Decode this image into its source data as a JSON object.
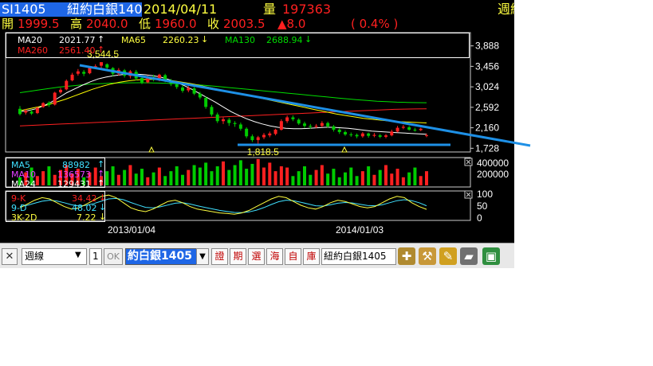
{
  "header": {
    "symbol": "SI1405",
    "name": "紐約白銀140",
    "date": "2014/04/11",
    "volume_label": "量",
    "volume_value": "197363",
    "period_label": "週綫",
    "open_label": "開",
    "open": "1999.5",
    "high_label": "高",
    "high": "2040.0",
    "low_label": "低",
    "low": "1960.0",
    "close_label": "收",
    "close": "2003.5",
    "change": "▲8.0",
    "change_pct": "( 0.4% )"
  },
  "price_legend": {
    "ma20_label": "MA20",
    "ma20_value": "2021.77",
    "ma65_label": "MA65",
    "ma65_value": "2260.23",
    "ma130_label": "MA130",
    "ma130_value": "2688.94",
    "ma260_label": "MA260",
    "ma260_value": "2561.40"
  },
  "volume_legend": {
    "ma5_label": "MA5",
    "ma5_value": "88982",
    "ma10_label": "MA10",
    "ma10_value": "136573",
    "ma24_label": "MA24",
    "ma24_value": "129431"
  },
  "kd_legend": {
    "k_label": "9-K",
    "k_value": "34.42",
    "d_label": "9-D",
    "d_value": "48.02",
    "j_label": "3K-2D",
    "j_value": "7.22"
  },
  "toolbar": {
    "period_select": "週線",
    "count_value": "1",
    "ok_label": "OK",
    "symbol_input": "約白銀1405",
    "buttons": [
      "證",
      "期",
      "選",
      "海",
      "自",
      "庫"
    ],
    "name_display": "紐約白銀1405"
  },
  "colors": {
    "up": "#ff2020",
    "down": "#00cc00",
    "ma20": "#ffffff",
    "ma65": "#ffff00",
    "ma130": "#00dd00",
    "ma260": "#ff2020",
    "trendline": "#1e90e6",
    "accent": "#1e66e6"
  },
  "chart_data": [
    {
      "type": "candlestick",
      "title": "SI1405 weekly",
      "y_ticks": [
        "3,888",
        "3,456",
        "3,024",
        "2,592",
        "2,160",
        "1,728"
      ],
      "ylim": [
        1700,
        4050
      ],
      "x_ticks": [
        "2013/01/04",
        "2014/01/03"
      ],
      "annotations": {
        "high": "3,544.5",
        "low": "1,818.5"
      },
      "candles": [
        [
          2560,
          2450,
          2620,
          2420
        ],
        [
          2480,
          2520,
          2560,
          2440
        ],
        [
          2500,
          2460,
          2540,
          2430
        ],
        [
          2470,
          2580,
          2600,
          2450
        ],
        [
          2600,
          2680,
          2700,
          2580
        ],
        [
          2690,
          2640,
          2720,
          2600
        ],
        [
          2650,
          2900,
          2920,
          2630
        ],
        [
          2910,
          2960,
          3000,
          2880
        ],
        [
          2970,
          3150,
          3180,
          2950
        ],
        [
          3160,
          3280,
          3320,
          3140
        ],
        [
          3300,
          3350,
          3400,
          3260
        ],
        [
          3340,
          3300,
          3380,
          3250
        ],
        [
          3310,
          3420,
          3460,
          3290
        ],
        [
          3420,
          3460,
          3500,
          3400
        ],
        [
          3470,
          3544,
          3544,
          3420
        ],
        [
          3500,
          3430,
          3520,
          3380
        ],
        [
          3420,
          3300,
          3440,
          3250
        ],
        [
          3300,
          3380,
          3420,
          3260
        ],
        [
          3370,
          3260,
          3400,
          3220
        ],
        [
          3250,
          3350,
          3380,
          3200
        ],
        [
          3340,
          3200,
          3380,
          3160
        ],
        [
          3210,
          3120,
          3240,
          3080
        ],
        [
          3120,
          3240,
          3270,
          3100
        ],
        [
          3230,
          3180,
          3280,
          3140
        ],
        [
          3170,
          3280,
          3300,
          3140
        ],
        [
          3270,
          3150,
          3300,
          3120
        ],
        [
          3150,
          3080,
          3190,
          3040
        ],
        [
          3080,
          3020,
          3120,
          2980
        ],
        [
          3010,
          2940,
          3060,
          2900
        ],
        [
          2950,
          3000,
          3040,
          2910
        ],
        [
          2990,
          2880,
          3020,
          2850
        ],
        [
          2880,
          2800,
          2920,
          2760
        ],
        [
          2790,
          2600,
          2820,
          2560
        ],
        [
          2600,
          2440,
          2640,
          2400
        ],
        [
          2440,
          2300,
          2480,
          2260
        ],
        [
          2300,
          2340,
          2380,
          2240
        ],
        [
          2330,
          2260,
          2370,
          2200
        ],
        [
          2260,
          2240,
          2300,
          2180
        ],
        [
          2230,
          2140,
          2270,
          2100
        ],
        [
          2140,
          1980,
          2170,
          1940
        ],
        [
          1980,
          1900,
          2020,
          1860
        ],
        [
          1900,
          1960,
          1990,
          1818.5
        ],
        [
          1960,
          2010,
          2050,
          1920
        ],
        [
          2000,
          2040,
          2080,
          1960
        ],
        [
          2030,
          2120,
          2140,
          2000
        ],
        [
          2120,
          2300,
          2340,
          2100
        ],
        [
          2300,
          2380,
          2420,
          2260
        ],
        [
          2380,
          2340,
          2420,
          2300
        ],
        [
          2330,
          2250,
          2360,
          2220
        ],
        [
          2250,
          2200,
          2290,
          2160
        ],
        [
          2200,
          2180,
          2240,
          2140
        ],
        [
          2180,
          2200,
          2240,
          2150
        ],
        [
          2200,
          2260,
          2300,
          2170
        ],
        [
          2260,
          2190,
          2290,
          2160
        ],
        [
          2190,
          2120,
          2220,
          2080
        ],
        [
          2120,
          2070,
          2150,
          2030
        ],
        [
          2070,
          2020,
          2100,
          1990
        ],
        [
          2020,
          2010,
          2060,
          1970
        ],
        [
          2010,
          1980,
          2040,
          1940
        ],
        [
          1980,
          2040,
          2070,
          1950
        ],
        [
          2040,
          1990,
          2060,
          1950
        ],
        [
          1990,
          2010,
          2050,
          1960
        ],
        [
          2000,
          1970,
          2030,
          1940
        ],
        [
          1970,
          2000,
          2030,
          1940
        ],
        [
          2000,
          2080,
          2120,
          1980
        ],
        [
          2080,
          2160,
          2200,
          2060
        ],
        [
          2160,
          2180,
          2220,
          2130
        ],
        [
          2170,
          2120,
          2200,
          2100
        ],
        [
          2120,
          2110,
          2160,
          2080
        ],
        [
          2110,
          2140,
          2160,
          2090
        ],
        [
          1999.5,
          2003.5,
          2040,
          1960
        ]
      ],
      "ma20": [
        2500,
        2520,
        2560,
        2620,
        2700,
        2800,
        2900,
        2980,
        3060,
        3130,
        3190,
        3230,
        3260,
        3280,
        3290,
        3290,
        3280,
        3260,
        3230,
        3180,
        3120,
        3050,
        2970,
        2880,
        2790,
        2700,
        2600,
        2500,
        2420,
        2350,
        2290,
        2240,
        2200,
        2170,
        2150,
        2140,
        2140,
        2150,
        2160,
        2170,
        2170,
        2160,
        2150,
        2130,
        2110,
        2090,
        2080,
        2070,
        2060,
        2050,
        2040,
        2030,
        2022
      ],
      "ma65": [
        2520,
        2560,
        2600,
        2640,
        2700,
        2760,
        2830,
        2900,
        2970,
        3030,
        3080,
        3120,
        3150,
        3170,
        3180,
        3180,
        3170,
        3150,
        3120,
        3090,
        3050,
        3010,
        2970,
        2930,
        2890,
        2850,
        2810,
        2770,
        2730,
        2690,
        2650,
        2610,
        2570,
        2530,
        2490,
        2450,
        2420,
        2390,
        2360,
        2340,
        2320,
        2300,
        2290,
        2280,
        2270,
        2262
      ],
      "ma130": [
        2900,
        2930,
        2960,
        2990,
        3020,
        3040,
        3060,
        3080,
        3090,
        3100,
        3105,
        3108,
        3110,
        3108,
        3104,
        3098,
        3090,
        3080,
        3066,
        3050,
        3030,
        3010,
        2990,
        2970,
        2950,
        2930,
        2910,
        2890,
        2870,
        2850,
        2830,
        2810,
        2790,
        2770,
        2750,
        2735,
        2720,
        2710,
        2700,
        2695,
        2690,
        2689
      ],
      "ma260": [
        2200,
        2210,
        2220,
        2230,
        2240,
        2250,
        2260,
        2270,
        2280,
        2290,
        2300,
        2310,
        2320,
        2330,
        2340,
        2350,
        2360,
        2370,
        2380,
        2390,
        2400,
        2410,
        2420,
        2430,
        2440,
        2450,
        2460,
        2470,
        2480,
        2490,
        2500,
        2510,
        2520,
        2530,
        2540,
        2550,
        2555,
        2558,
        2561
      ],
      "trendline": {
        "from": [
          3544.5
        ],
        "to": [
          1728
        ]
      },
      "support": 1818.5
    },
    {
      "type": "bar",
      "title": "Volume",
      "y_ticks": [
        "400000",
        "200000"
      ],
      "ylim": [
        0,
        400000
      ]
    },
    {
      "type": "line",
      "title": "KD",
      "y_ticks": [
        "100",
        "50",
        "0"
      ],
      "ylim": [
        0,
        100
      ],
      "k": [
        40,
        55,
        70,
        80,
        75,
        60,
        45,
        35,
        40,
        55,
        70,
        85,
        90,
        80,
        60,
        40,
        30,
        25,
        35,
        50,
        65,
        70,
        60,
        45,
        35,
        30,
        25,
        20,
        18,
        15,
        20,
        30,
        45,
        60,
        75,
        85,
        80,
        65,
        50,
        40,
        35,
        45,
        60,
        70,
        65,
        55,
        45,
        40,
        45,
        60,
        75,
        85,
        80,
        60,
        45,
        34
      ],
      "d": [
        45,
        50,
        58,
        66,
        70,
        67,
        60,
        52,
        47,
        50,
        57,
        66,
        75,
        77,
        72,
        61,
        51,
        42,
        40,
        44,
        51,
        58,
        60,
        55,
        48,
        42,
        36,
        30,
        26,
        22,
        21,
        24,
        31,
        41,
        53,
        64,
        70,
        68,
        62,
        55,
        48,
        47,
        52,
        58,
        61,
        59,
        54,
        49,
        48,
        52,
        60,
        68,
        72,
        68,
        60,
        48
      ]
    }
  ]
}
